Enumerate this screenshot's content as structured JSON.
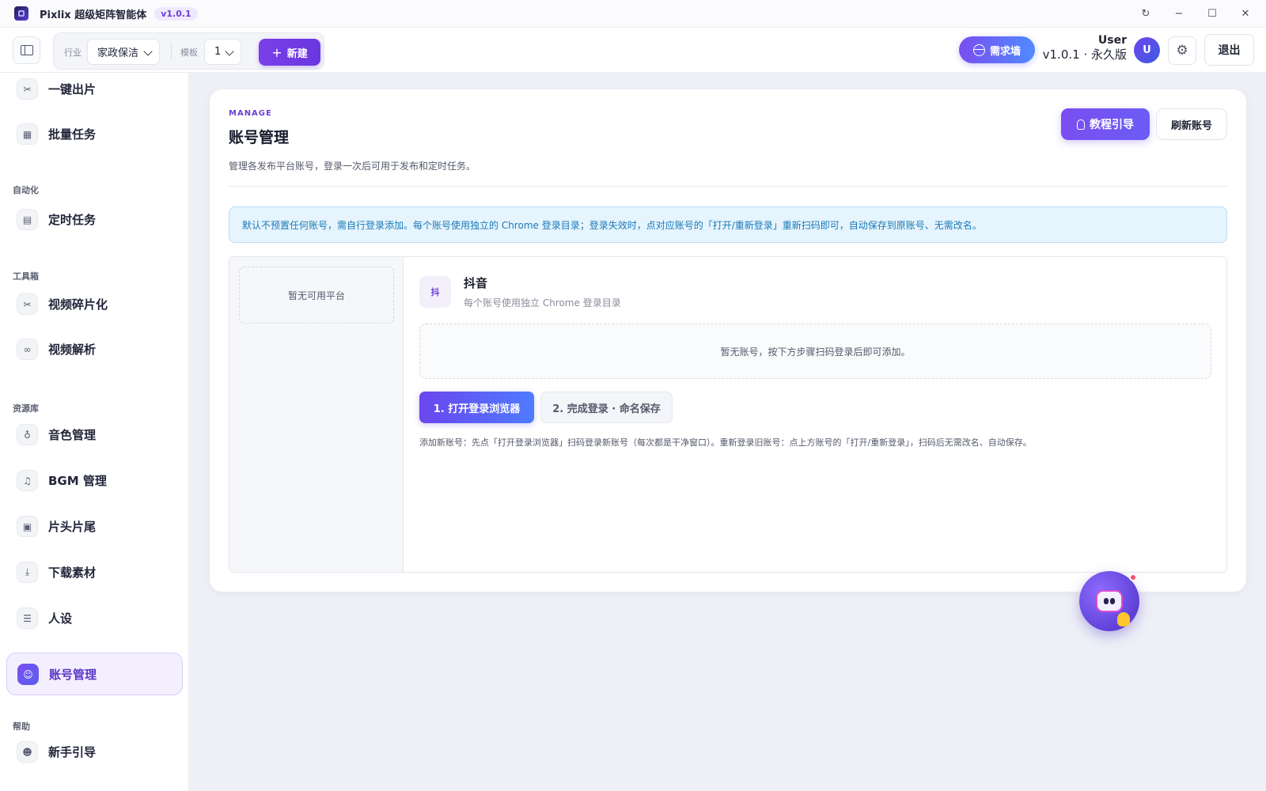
{
  "app": {
    "title": "Pixlix 超级矩阵智能体",
    "version": "v1.0.1"
  },
  "toolbar": {
    "industry_label": "行业",
    "industry_value": "家政保洁",
    "template_label": "模板",
    "template_value": "1",
    "new_button": "新建",
    "demand_button": "需求墙",
    "user_name": "User",
    "user_edition": "v1.0.1 · 永久版",
    "avatar_initial": "U",
    "logout_button": "退出"
  },
  "sidebar": {
    "items_top": [
      {
        "label": "一键出片",
        "icon": "scissors-icon"
      },
      {
        "label": "批量任务",
        "icon": "grid-icon"
      }
    ],
    "section_automation": "自动化",
    "item_schedule": {
      "label": "定时任务",
      "icon": "calendar-icon"
    },
    "section_toolbox": "工具箱",
    "items_toolbox": [
      {
        "label": "视频碎片化",
        "icon": "scissors-icon"
      },
      {
        "label": "视频解析",
        "icon": "link-icon"
      }
    ],
    "section_library": "资源库",
    "items_library": [
      {
        "label": "音色管理",
        "icon": "microphone-icon"
      },
      {
        "label": "BGM 管理",
        "icon": "music-icon"
      },
      {
        "label": "片头片尾",
        "icon": "film-icon"
      },
      {
        "label": "下载素材",
        "icon": "download-icon"
      },
      {
        "label": "人设",
        "icon": "persona-icon"
      },
      {
        "label": "账号管理",
        "icon": "users-icon",
        "active": true
      }
    ],
    "section_help": "帮助",
    "item_guide": {
      "label": "新手引导",
      "icon": "user-icon"
    }
  },
  "main": {
    "eyebrow": "MANAGE",
    "title": "账号管理",
    "description": "管理各发布平台账号，登录一次后可用于发布和定时任务。",
    "guide_button": "教程引导",
    "refresh_button": "刷新账号",
    "notice": "默认不预置任何账号，需自行登录添加。每个账号使用独立的 Chrome 登录目录；登录失效时，点对应账号的「打开/重新登录」重新扫码即可，自动保存到原账号、无需改名。",
    "empty_platform": "暂无可用平台",
    "platform": {
      "icon_char": "抖",
      "name": "抖音",
      "subtitle": "每个账号使用独立 Chrome 登录目录"
    },
    "empty_accounts": "暂无账号，按下方步骤扫码登录后即可添加。",
    "step1_button": "1. 打开登录浏览器",
    "step2_button": "2. 完成登录 · 命名保存",
    "hint": "添加新账号：先点「打开登录浏览器」扫码登录新账号（每次都是干净窗口）。重新登录旧账号：点上方账号的「打开/重新登录」，扫码后无需改名、自动保存。"
  },
  "colors": {
    "accent": "#6b3fd4",
    "notice_text": "#1a7ab8",
    "notice_bg": "#e6f4fd"
  }
}
